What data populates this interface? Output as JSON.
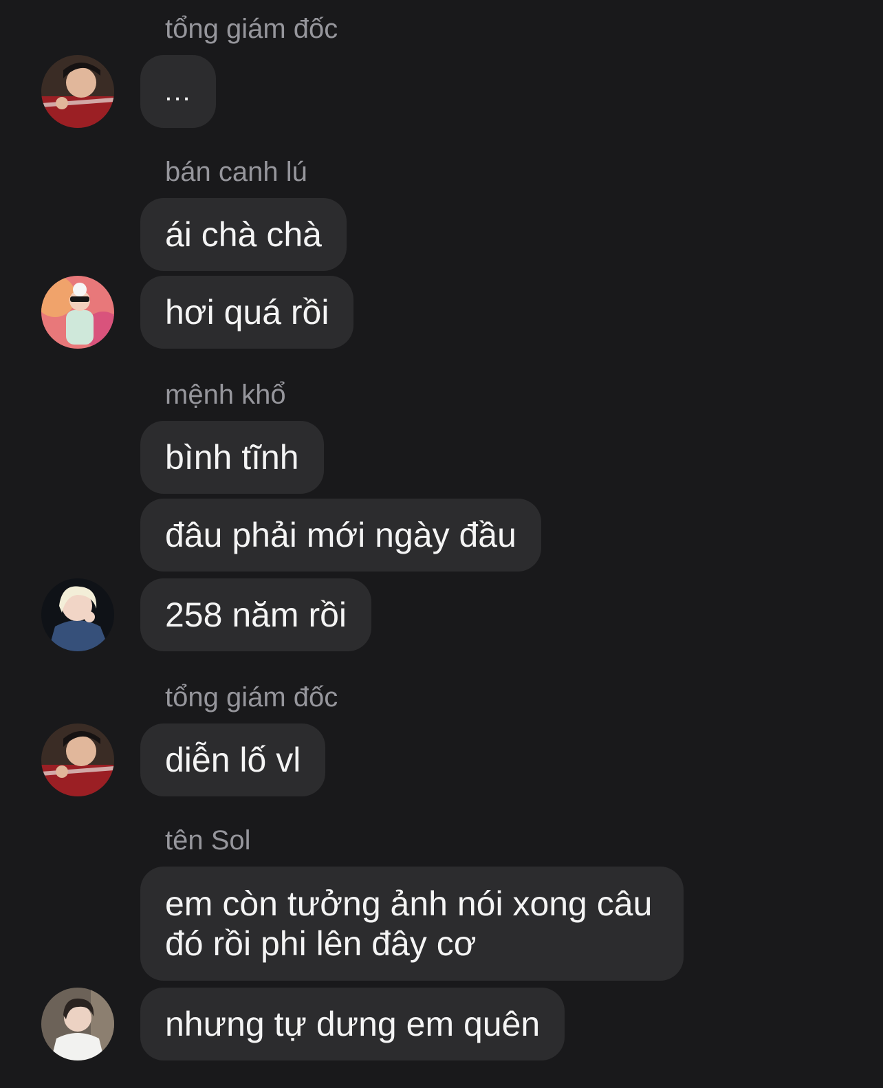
{
  "messages": [
    {
      "sender": "tổng giám đốc",
      "bubbles": [
        "..."
      ]
    },
    {
      "sender": "bán canh lú",
      "bubbles": [
        "ái chà chà",
        "hơi quá rồi"
      ]
    },
    {
      "sender": "mệnh khổ",
      "bubbles": [
        "bình tĩnh",
        "đâu phải mới ngày đầu",
        "258 năm rồi"
      ]
    },
    {
      "sender": "tổng giám đốc",
      "bubbles": [
        "diễn lố vl"
      ]
    },
    {
      "sender": "tên Sol",
      "bubbles": [
        "em còn tưởng ảnh nói xong câu đó rồi phi lên đây cơ",
        "nhưng tự dưng em quên"
      ]
    }
  ],
  "avatars": [
    "boy-red-shirt-avatar",
    "girl-colorful-avatar",
    "blonde-avatar",
    "boy-red-shirt-avatar",
    "boy-white-shirt-avatar"
  ],
  "colors": {
    "background": "#19191b",
    "bubble": "#2c2c2e",
    "sender_name": "#96969c",
    "text": "#f4f4f4"
  }
}
